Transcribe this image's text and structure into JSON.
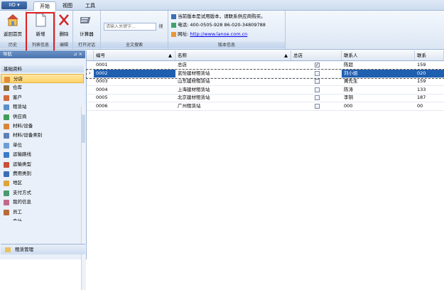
{
  "ribbon_tabs": {
    "app": "IIO ▾",
    "start": "开始",
    "view": "视图",
    "tools": "工具"
  },
  "groups": {
    "history": {
      "label": "历史",
      "btn": "返回首页"
    },
    "list": {
      "label": "列表信息",
      "btn": "新增"
    },
    "edit": {
      "label": "编辑",
      "btn": "删除"
    },
    "calc": {
      "label": "打开对话",
      "btn": "计算器"
    },
    "search": {
      "label": "全文搜索",
      "placeholder": "请输入关键字...",
      "btn": "搜"
    },
    "info": {
      "label": "版本信息",
      "line1": "当前版本是试用版本，请联系供应商购买。",
      "line2": "电话:  400-0505-928  86-020-34809788",
      "line3_prefix": "网址:",
      "line3_link": "http://www.lanoe.com.cn"
    }
  },
  "nav": {
    "title": "导航",
    "pin": "⊿ ×",
    "group": "基础资料",
    "items": [
      "分店",
      "仓库",
      "客户",
      "租赁站",
      "供应商",
      "材料/设备",
      "材料/设备类别",
      "单位",
      "运输路线",
      "运输类型",
      "费用类别",
      "地区",
      "支付方式",
      "我的信息",
      "员工"
    ],
    "bottom": "租赁管理",
    "partial": "会计"
  },
  "grid": {
    "headers": [
      "编号",
      "名称",
      "总店",
      "联系人",
      "联系"
    ],
    "rows": [
      {
        "code": "0001",
        "name": "总店",
        "hq": true,
        "contact": "陈超",
        "phone": "159"
      },
      {
        "code": "0002",
        "name": "蓝怡建材租赁站",
        "hq": false,
        "contact": "刘小姐",
        "phone": "020"
      },
      {
        "code": "0003",
        "name": "山东建材租赁站",
        "hq": false,
        "contact": "黄先生",
        "phone": "159"
      },
      {
        "code": "0004",
        "name": "上海建材租赁站",
        "hq": false,
        "contact": "陈涛",
        "phone": "133"
      },
      {
        "code": "0005",
        "name": "北京建材租赁站",
        "hq": false,
        "contact": "李铜",
        "phone": "187"
      },
      {
        "code": "0006",
        "name": "广州租赁站",
        "hq": false,
        "contact": "000",
        "phone": "00"
      }
    ]
  },
  "colors": {
    "selection": "#1f5fb0",
    "highlight_box": "#e02020",
    "nav_selected": "#ffd36a"
  }
}
